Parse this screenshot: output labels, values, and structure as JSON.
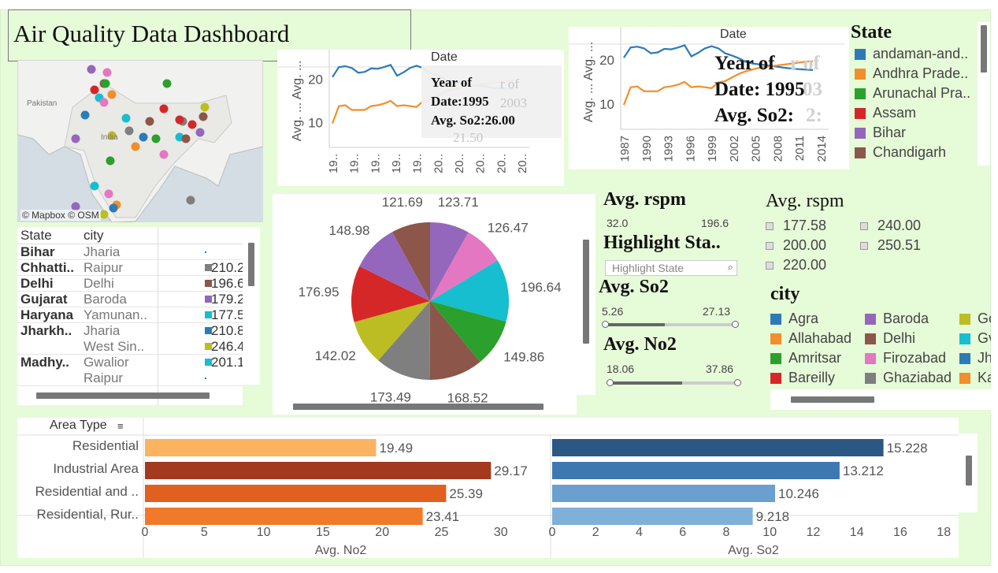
{
  "title": "Air Quality Data Dashboard",
  "map": {
    "credit": "© Mapbox © OSM",
    "labels": [
      "Pakistan",
      "India"
    ]
  },
  "line_charts": [
    {
      "header": "Date",
      "ylabel": "Avg. ... Avg. ...",
      "yticks": [
        "20",
        "10"
      ],
      "xticks": [
        "19..",
        "19..",
        "19..",
        "19..",
        "19..",
        "20..",
        "20..",
        "20..",
        "20..",
        "20.."
      ],
      "tooltip": [
        "Year of",
        "Date:1995",
        "Avg. So2:26.00"
      ],
      "ghost_tooltip": [
        "r of",
        "2003",
        "21.50"
      ]
    },
    {
      "header": "Date",
      "ylabel": "Avg. ... Avg. ...",
      "yticks": [
        "20",
        "10"
      ],
      "xticks": [
        "1987",
        "1990",
        "1993",
        "1996",
        "1999",
        "2002",
        "2005",
        "2008",
        "2011",
        "2014"
      ],
      "tooltip": [
        "Year of",
        "Date: 1995",
        "Avg. So2:"
      ],
      "ghost_tooltip": [
        "r of",
        "03",
        "2:"
      ]
    }
  ],
  "chart_data": [
    {
      "type": "line",
      "x": [
        "1987",
        "1988",
        "1989",
        "1990",
        "1991",
        "1992",
        "1993",
        "1994",
        "1995",
        "1996",
        "1997",
        "1998",
        "1999",
        "2000",
        "2001",
        "2002",
        "2003",
        "2004",
        "2005",
        "2006",
        "2007",
        "2008",
        "2009",
        "2010",
        "2011",
        "2012",
        "2013",
        "2014",
        "2015"
      ],
      "series": [
        {
          "values": [
            20.5,
            22.8,
            23.0,
            22.6,
            21.5,
            21.7,
            22.5,
            22.4,
            22.8,
            23.3,
            20.8,
            21.6,
            22.6,
            23.1,
            22.6,
            21.5,
            21.0,
            20.4,
            19.6,
            19.2,
            19.0,
            18.8,
            18.6,
            18.4,
            18.2,
            18.0,
            17.9,
            17.8,
            17.7
          ],
          "color": "#2c7bb6"
        },
        {
          "values": [
            9.8,
            13.8,
            14.0,
            12.9,
            12.9,
            12.9,
            13.8,
            14.0,
            14.4,
            15.0,
            13.8,
            14.0,
            13.8,
            13.6,
            14.9,
            15.2,
            16.0,
            16.8,
            17.4,
            17.8,
            18.2,
            18.4,
            18.6,
            18.8,
            19.0,
            19.2,
            19.4,
            19.6,
            19.7
          ],
          "color": "#f28e2b"
        }
      ],
      "ylim": [
        5,
        25
      ]
    },
    {
      "type": "line",
      "x": [
        "1987",
        "1988",
        "1989",
        "1990",
        "1991",
        "1992",
        "1993",
        "1994",
        "1995",
        "1996",
        "1997",
        "1998",
        "1999",
        "2000",
        "2001",
        "2002",
        "2003",
        "2004",
        "2005",
        "2006",
        "2007",
        "2008",
        "2009",
        "2010",
        "2011",
        "2012",
        "2013",
        "2014",
        "2015"
      ],
      "series": [
        {
          "values": [
            20.5,
            22.8,
            23.0,
            22.6,
            21.5,
            21.7,
            22.5,
            22.4,
            22.8,
            23.3,
            20.8,
            21.6,
            22.6,
            23.1,
            22.6,
            21.5,
            21.0,
            20.4,
            19.6,
            19.2,
            19.0,
            18.8,
            18.6,
            18.4,
            18.2,
            18.0,
            17.9,
            17.8,
            17.7
          ],
          "color": "#2c7bb6"
        },
        {
          "values": [
            9.8,
            13.8,
            14.0,
            12.9,
            12.9,
            12.9,
            13.8,
            14.0,
            14.4,
            15.0,
            13.8,
            14.0,
            13.8,
            13.6,
            14.9,
            15.2,
            16.0,
            16.8,
            17.4,
            17.8,
            18.2,
            18.4,
            18.6,
            18.8,
            19.0,
            19.2,
            19.4,
            19.6,
            19.7
          ],
          "color": "#f28e2b"
        }
      ],
      "ylim": [
        5,
        25
      ]
    },
    {
      "type": "pie",
      "values": [
        123.71,
        126.47,
        196.64,
        149.86,
        168.52,
        173.49,
        142.02,
        176.95,
        148.98,
        121.69
      ],
      "labels": [
        "123.71",
        "126.47",
        "196.64",
        "149.86",
        "168.52",
        "173.49",
        "142.02",
        "176.95",
        "148.98",
        "121.69"
      ],
      "colors": [
        "#9467bd",
        "#e377c2",
        "#17becf",
        "#2ca02c",
        "#8c564b",
        "#7f7f7f",
        "#bcbd22",
        "#d62728",
        "#9467bd",
        "#8c564b"
      ]
    },
    {
      "type": "bar",
      "title": "",
      "xlabel": "Avg. No2",
      "categories": [
        "Residential",
        "Industrial Area",
        "Residential and ..",
        "Residential, Rur.."
      ],
      "values": [
        19.49,
        29.17,
        25.39,
        23.41
      ],
      "labels": [
        "19.49",
        "29.17",
        "25.39",
        "23.41"
      ],
      "colors": [
        "#fbb360",
        "#a3391e",
        "#e0611f",
        "#f07a2a"
      ],
      "xlim": [
        0,
        33
      ],
      "xticks": [
        "0",
        "5",
        "10",
        "15",
        "20",
        "25",
        "30"
      ]
    },
    {
      "type": "bar",
      "xlabel": "Avg. So2",
      "categories": [
        "Residential",
        "Industrial Area",
        "Residential and ..",
        "Residential, Rur.."
      ],
      "values": [
        15.228,
        13.212,
        10.246,
        9.218
      ],
      "labels": [
        "15.228",
        "13.212",
        "10.246",
        "9.218"
      ],
      "colors": [
        "#2a5783",
        "#3d78b0",
        "#6a9fcf",
        "#7fb0d8"
      ],
      "xlim": [
        0,
        18.5
      ],
      "xticks": [
        "0",
        "2",
        "4",
        "6",
        "8",
        "10",
        "12",
        "14",
        "16",
        "18"
      ]
    }
  ],
  "state_legend": {
    "title": "State",
    "items": [
      {
        "label": "andaman-and..",
        "color": "#2c7bb6"
      },
      {
        "label": "Andhra Prade..",
        "color": "#f28e2b"
      },
      {
        "label": "Arunachal Pra..",
        "color": "#2ca02c"
      },
      {
        "label": "Assam",
        "color": "#d62728"
      },
      {
        "label": "Bihar",
        "color": "#9467bd"
      },
      {
        "label": "Chandigarh",
        "color": "#8c564b"
      }
    ]
  },
  "table": {
    "headers": [
      "State",
      "city"
    ],
    "rows": [
      {
        "state": "Bihar",
        "cities": [
          "Jharia"
        ],
        "values": [
          ""
        ],
        "colors": [
          "#2c7bb6"
        ]
      },
      {
        "state": "Chhatti..",
        "cities": [
          "Raipur"
        ],
        "values": [
          "210.2"
        ],
        "colors": [
          "#7f7f7f"
        ]
      },
      {
        "state": "Delhi",
        "cities": [
          "Delhi"
        ],
        "values": [
          "196.6"
        ],
        "colors": [
          "#8c564b"
        ]
      },
      {
        "state": "Gujarat",
        "cities": [
          "Baroda"
        ],
        "values": [
          "179.2"
        ],
        "colors": [
          "#9467bd"
        ]
      },
      {
        "state": "Haryana",
        "cities": [
          "Yamunan.."
        ],
        "values": [
          "177.5"
        ],
        "colors": [
          "#17becf"
        ]
      },
      {
        "state": "Jharkh..",
        "cities": [
          "Jharia",
          "West Sin.."
        ],
        "values": [
          "210.8",
          "246.4"
        ],
        "colors": [
          "#2c7bb6",
          "#bcbd22"
        ]
      },
      {
        "state": "Madhy..",
        "cities": [
          "Gwalior",
          "Raipur"
        ],
        "values": [
          "201.1",
          ""
        ],
        "colors": [
          "#17becf",
          "#2c7bb6"
        ]
      }
    ]
  },
  "filters": {
    "rspm_title": "Avg. rspm",
    "rspm_min": "32.0",
    "rspm_max": "196.6",
    "highlight_title": "Highlight Sta..",
    "highlight_placeholder": "Highlight State",
    "so2_title": "Avg. So2",
    "so2_min": "5.26",
    "so2_max": "27.13",
    "no2_title": "Avg. No2",
    "no2_min": "18.06",
    "no2_max": "37.86"
  },
  "rspm_legend": {
    "title": "Avg. rspm",
    "items": [
      "177.58",
      "240.00",
      "200.00",
      "250.51",
      "220.00"
    ]
  },
  "city_legend": {
    "title": "city",
    "items": [
      {
        "label": "Agra",
        "color": "#2c7bb6"
      },
      {
        "label": "Baroda",
        "color": "#9467bd"
      },
      {
        "label": "Go",
        "color": "#bcbd22"
      },
      {
        "label": "Allahabad",
        "color": "#f28e2b"
      },
      {
        "label": "Delhi",
        "color": "#8c564b"
      },
      {
        "label": "Gv",
        "color": "#17becf"
      },
      {
        "label": "Amritsar",
        "color": "#2ca02c"
      },
      {
        "label": "Firozabad",
        "color": "#e377c2"
      },
      {
        "label": "Jh",
        "color": "#2c7bb6"
      },
      {
        "label": "Bareilly",
        "color": "#d62728"
      },
      {
        "label": "Ghaziabad",
        "color": "#7f7f7f"
      },
      {
        "label": "Ka",
        "color": "#f28e2b"
      }
    ]
  },
  "bar_section": {
    "header": "Area Type",
    "sort_icon": "sort-icon"
  }
}
